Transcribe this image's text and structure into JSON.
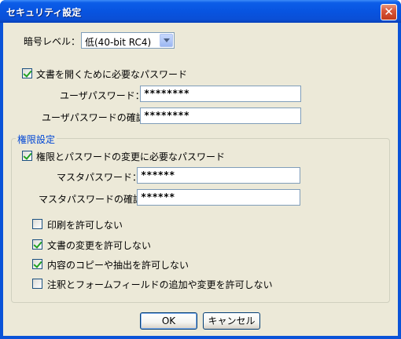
{
  "window": {
    "title": "セキュリティ設定",
    "close_glyph": "✕"
  },
  "encryption": {
    "label": "暗号レベル：",
    "selected": "低(40-bit RC4)"
  },
  "open_password": {
    "checkbox_label": "文書を開くために必要なパスワード",
    "checked": true,
    "user_password_label": "ユーザパスワード：",
    "user_password_value": "********",
    "user_password_confirm_label": "ユーザパスワードの確認：",
    "user_password_confirm_value": "********"
  },
  "permissions": {
    "group_title": "権限設定",
    "checkbox_label": "権限とパスワードの変更に必要なパスワード",
    "checked": true,
    "master_password_label": "マスタパスワード：",
    "master_password_value": "******",
    "master_password_confirm_label": "マスタパスワードの確認：",
    "master_password_confirm_value": "******",
    "options": [
      {
        "label": "印刷を許可しない",
        "checked": false
      },
      {
        "label": "文書の変更を許可しない",
        "checked": true
      },
      {
        "label": "内容のコピーや抽出を許可しない",
        "checked": true
      },
      {
        "label": "注釈とフォームフィールドの追加や変更を許可しない",
        "checked": false
      }
    ]
  },
  "buttons": {
    "ok_label": "OK",
    "cancel_label": "キャンセル"
  },
  "colors": {
    "titlebar": "#0a53d8",
    "dialog_bg": "#ece9d8",
    "group_title": "#0046d5",
    "check_mark": "#21a121"
  }
}
